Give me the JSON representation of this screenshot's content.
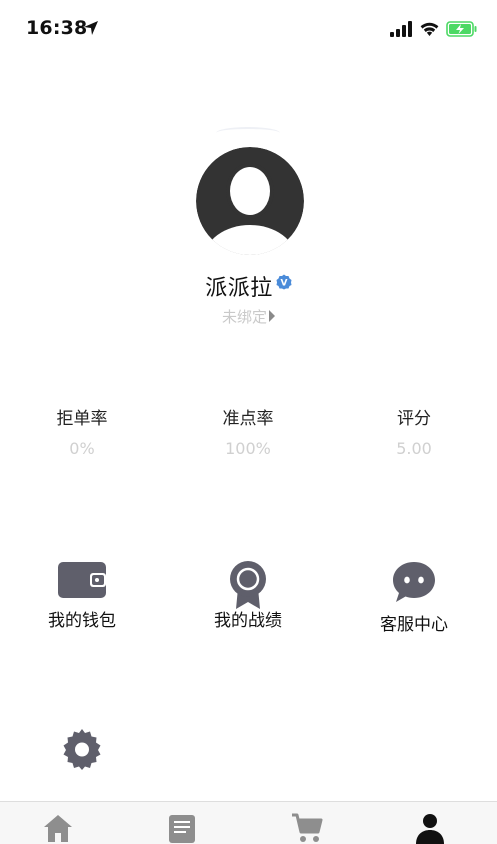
{
  "status_bar": {
    "time": "16:38"
  },
  "profile": {
    "username": "派派拉",
    "verified_badge": "V",
    "bind_status": "未绑定"
  },
  "stats": [
    {
      "label": "拒单率",
      "value": "0%"
    },
    {
      "label": "准点率",
      "value": "100%"
    },
    {
      "label": "评分",
      "value": "5.00"
    }
  ],
  "menu": [
    {
      "label": "我的钱包",
      "icon": "wallet-icon"
    },
    {
      "label": "我的战绩",
      "icon": "medal-icon"
    },
    {
      "label": "客服中心",
      "icon": "chat-icon"
    },
    {
      "label": "",
      "icon": "gear-icon"
    }
  ],
  "tab_bar": {
    "items": [
      {
        "icon": "home-icon"
      },
      {
        "icon": "list-icon"
      },
      {
        "icon": "cart-icon"
      },
      {
        "icon": "person-icon",
        "active": true
      }
    ]
  },
  "colors": {
    "icon_gray": "#5f5f6b",
    "muted_text": "#d0d0d0",
    "verified_blue": "#4a8bd9",
    "battery_green": "#4cd964"
  }
}
